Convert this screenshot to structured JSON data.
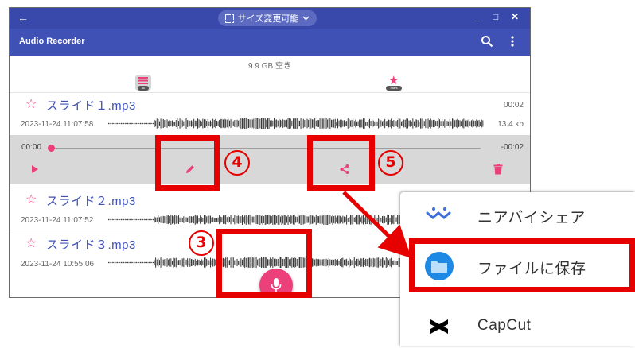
{
  "titlebar": {
    "resize_label": "サイズ変更可能"
  },
  "appbar": {
    "title": "Audio Recorder"
  },
  "storage": {
    "free": "9.9 GB 空き"
  },
  "tabs": {
    "all_label": "All",
    "stars_label": "Stars"
  },
  "recordings": [
    {
      "name": "スライド１.mp3",
      "duration": "00:02",
      "date": "2023-11-24 11:07:58",
      "size": "13.4 kb"
    },
    {
      "name": "スライド２.mp3",
      "duration": "",
      "date": "2023-11-24 11:07:52",
      "size": ""
    },
    {
      "name": "スライド３.mp3",
      "duration": "",
      "date": "2023-11-24 10:55:06",
      "size": ""
    }
  ],
  "player": {
    "current": "00:00",
    "remaining": "-00:02",
    "progress": 0.0
  },
  "callouts": {
    "record": "3",
    "edit": "4",
    "share": "5"
  },
  "share_sheet": {
    "items": [
      {
        "label": "ニアバイシェア",
        "icon": "nearby-share-icon"
      },
      {
        "label": "ファイルに保存",
        "icon": "files-folder-icon"
      },
      {
        "label": "CapCut",
        "icon": "capcut-icon"
      }
    ]
  },
  "colors": {
    "primary": "#3f51b5",
    "accent": "#ec407a",
    "highlight": "#e60000",
    "player_bg": "#d8d8d8"
  }
}
